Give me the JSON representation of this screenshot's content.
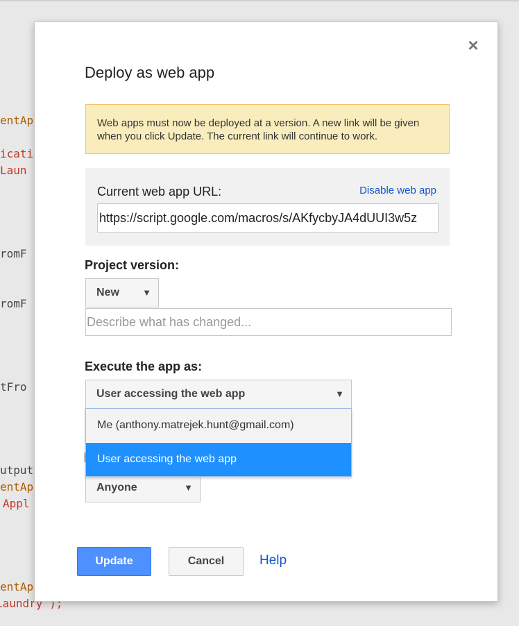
{
  "background_code": [
    {
      "text": "entAp",
      "color": "#b05a00"
    },
    {
      "text": "icati",
      "color": "#c0392b"
    },
    {
      "text": "Laun",
      "color": "#c0392b"
    },
    {
      "text": "romF",
      "color": "#444444"
    },
    {
      "text": "romF",
      "color": "#444444"
    },
    {
      "text": "tFro",
      "color": "#444444"
    },
    {
      "text": "utput",
      "color": "#444444"
    },
    {
      "text": "entAp",
      "color": "#b05a00"
    },
    {
      "text": "Appl",
      "color": "#c0392b"
    },
    {
      "text": "entAp",
      "color": "#b05a00"
    },
    {
      "text": "Laundry );",
      "color": "#c0392b"
    }
  ],
  "dialog": {
    "title": "Deploy as web app",
    "close_label": "×",
    "warning": "Web apps must now be deployed at a version. A new link will be given when you click Update. The current link will continue to work.",
    "current_url_label": "Current web app URL:",
    "disable_link": "Disable web app",
    "current_url_value": "https://script.google.com/macros/s/AKfycbyJA4dUUI3w5z",
    "project_version_label": "Project version:",
    "project_version_selected": "New",
    "describe_placeholder": "Describe what has changed...",
    "execute_label": "Execute the app as:",
    "execute_selected": "User accessing the web app",
    "execute_options": [
      "Me (anthony.matrejek.hunt@gmail.com)",
      "User accessing the web app"
    ],
    "access_selected": "Anyone",
    "arrow": "▼",
    "buttons": {
      "update": "Update",
      "cancel": "Cancel",
      "help": "Help"
    }
  },
  "colors": {
    "primary_button": "#4d90fe",
    "link": "#1155cc",
    "selected_option": "#1e90ff",
    "warning_bg": "#f9edbe"
  }
}
